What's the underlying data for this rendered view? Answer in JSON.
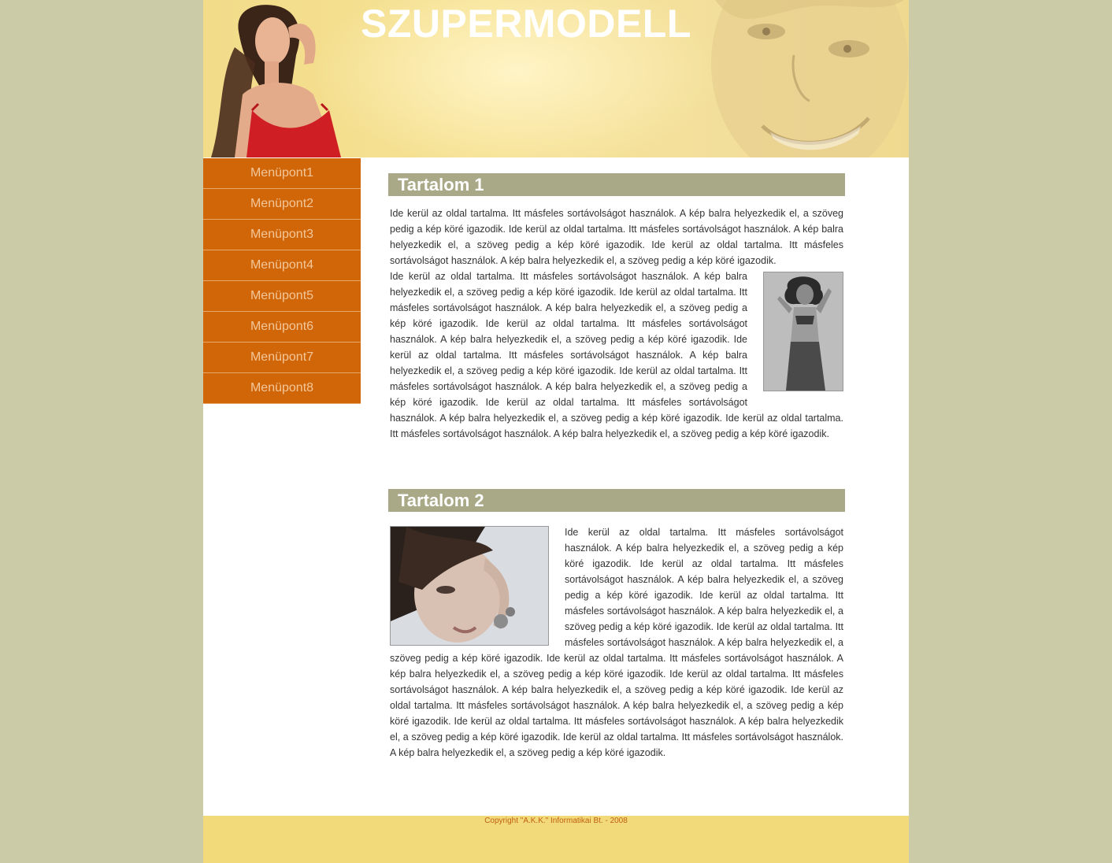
{
  "header": {
    "title": "SZUPERMODELL"
  },
  "menu": {
    "items": [
      "Menüpont1",
      "Menüpont2",
      "Menüpont3",
      "Menüpont4",
      "Menüpont5",
      "Menüpont6",
      "Menüpont7",
      "Menüpont8"
    ]
  },
  "content": {
    "section1": {
      "title": "Tartalom 1",
      "text": "Ide kerül az oldal tartalma. Itt másfeles sortávolságot használok. A kép balra helyezkedik el, a szöveg pedig a kép köré igazodik. Ide kerül az oldal tartalma. Itt másfeles sortávolságot használok. A kép balra helyezkedik el, a szöveg pedig a kép köré igazodik. Ide kerül az oldal tartalma. Itt másfeles sortávolságot használok. A kép balra helyezkedik el, a szöveg pedig a kép köré igazodik.",
      "text_wrap": "Ide kerül az oldal tartalma. Itt másfeles sortávolságot használok. A kép balra helyezkedik el, a szöveg pedig a kép köré igazodik. Ide kerül az oldal tartalma. Itt másfeles sortávolságot használok. A kép balra helyezkedik el, a szöveg pedig a kép köré igazodik. Ide kerül az oldal tartalma. Itt másfeles sortávolságot használok. A kép balra helyezkedik el, a szöveg pedig a kép köré igazodik. Ide kerül az oldal tartalma. Itt másfeles sortávolságot használok. A kép balra helyezkedik el, a szöveg pedig a kép köré igazodik. Ide kerül az oldal tartalma. Itt másfeles sortávolságot használok. A kép balra helyezkedik el, a szöveg pedig a kép köré igazodik. Ide kerül az oldal tartalma. Itt másfeles sortávolságot használok. A kép balra helyezkedik el, a szöveg pedig a kép köré igazodik. Ide kerül az oldal tartalma. Itt másfeles sortávolságot használok. A kép balra helyezkedik el, a szöveg pedig a kép köré igazodik."
    },
    "section2": {
      "title": "Tartalom 2",
      "text": "Ide kerül az oldal tartalma. Itt másfeles sortávolságot használok. A kép balra helyezkedik el, a szöveg pedig a kép köré igazodik. Ide kerül az oldal tartalma. Itt másfeles sortávolságot használok. A kép balra helyezkedik el, a szöveg pedig a kép köré igazodik. Ide kerül az oldal tartalma. Itt másfeles sortávolságot használok. A kép balra helyezkedik el, a szöveg pedig a kép köré igazodik. Ide kerül az oldal tartalma. Itt másfeles sortávolságot használok. A kép balra helyezkedik el, a szöveg pedig a kép köré igazodik. Ide kerül az oldal tartalma. Itt másfeles sortávolságot használok. A kép balra helyezkedik el, a szöveg pedig a kép köré igazodik. Ide kerül az oldal tartalma. Itt másfeles sortávolságot használok. A kép balra helyezkedik el, a szöveg pedig a kép köré igazodik. Ide kerül az oldal tartalma. Itt másfeles sortávolságot használok. A kép balra helyezkedik el, a szöveg pedig a kép köré igazodik. Ide kerül az oldal tartalma. Itt másfeles sortávolságot használok. A kép balra helyezkedik el, a szöveg pedig a kép köré igazodik. Ide kerül az oldal tartalma. Itt másfeles sortávolságot használok. A kép balra helyezkedik el, a szöveg pedig a kép köré igazodik."
    }
  },
  "footer": {
    "copyright": "Copyright \"A.K.K.\" Informatikai Bt. - 2008"
  },
  "colors": {
    "background": "#cccba8",
    "menu": "#d06608",
    "menu_text": "#f3c79a",
    "section_head": "#a9a988",
    "footer": "#f2da7b",
    "copyright_text": "#c06010"
  }
}
